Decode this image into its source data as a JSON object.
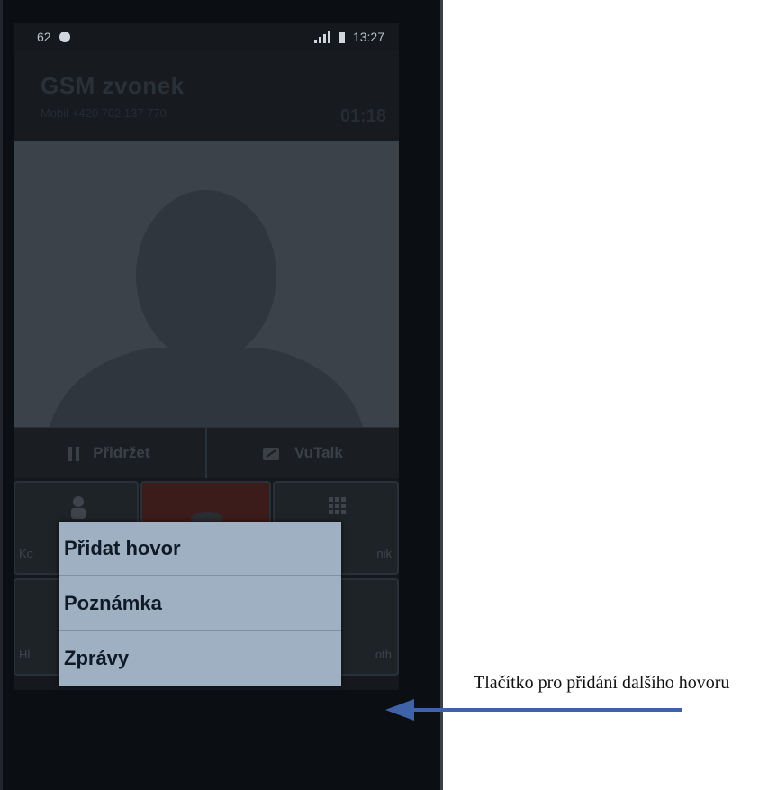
{
  "status_bar": {
    "left_text": "62",
    "time": "13:27"
  },
  "call": {
    "caller_name": "GSM zvonek",
    "caller_number": "Mobil +420 702 137 770",
    "timer": "01:18"
  },
  "actions": {
    "hold_label": "Přidržet",
    "vutalk_label": "VuTalk"
  },
  "grid_partial_labels": {
    "contacts": "Ko",
    "keypad": "nik",
    "hold2": "Hl",
    "bluetooth": "oth"
  },
  "popup_menu": {
    "items": [
      "Přidat hovor",
      "Poznámka",
      "Zprávy"
    ]
  },
  "annotation": {
    "text": "Tlačítko pro přidání dalšího hovoru"
  },
  "colors": {
    "popup_bg": "#9fb0c2",
    "arrow": "#3f63a8"
  },
  "icons": [
    "signal-icon",
    "battery-icon",
    "pause-icon",
    "vutalk-icon",
    "person-icon",
    "phone-icon",
    "keypad-icon",
    "back-icon"
  ]
}
